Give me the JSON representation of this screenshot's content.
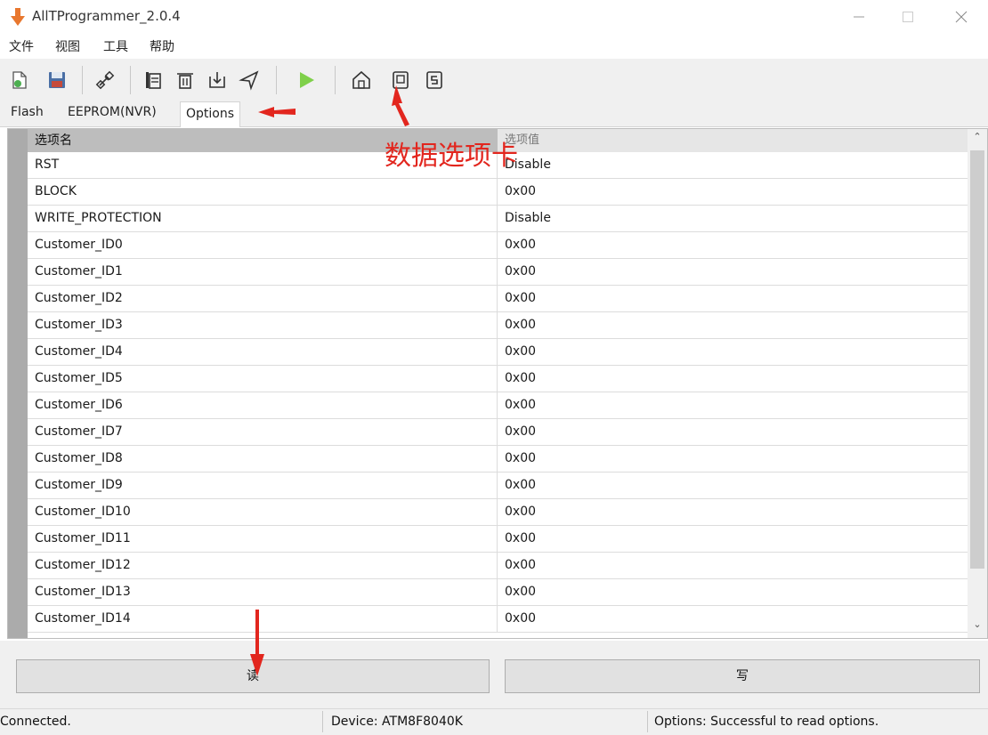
{
  "window": {
    "title": "AllTProgrammer_2.0.4",
    "min_icon": "minimize-icon",
    "max_icon": "maximize-icon",
    "close_icon": "close-icon"
  },
  "menu": [
    "文件",
    "视图",
    "工具",
    "帮助"
  ],
  "toolbar": {
    "icons": [
      "new-file-icon",
      "save-icon",
      "connect-icon",
      "copy-icon",
      "erase-icon",
      "download-icon",
      "send-icon",
      "run-icon",
      "home-icon",
      "data-option-icon",
      "s-icon"
    ]
  },
  "tabs": [
    {
      "label": "Flash"
    },
    {
      "label": "EEPROM(NVR)"
    },
    {
      "label": "Options"
    }
  ],
  "grid": {
    "headers": [
      "选项名",
      "选项值"
    ],
    "rows": [
      {
        "name": "RST",
        "value": "Disable"
      },
      {
        "name": "BLOCK",
        "value": "0x00"
      },
      {
        "name": "WRITE_PROTECTION",
        "value": "Disable"
      },
      {
        "name": "Customer_ID0",
        "value": "0x00"
      },
      {
        "name": "Customer_ID1",
        "value": "0x00"
      },
      {
        "name": "Customer_ID2",
        "value": "0x00"
      },
      {
        "name": "Customer_ID3",
        "value": "0x00"
      },
      {
        "name": "Customer_ID4",
        "value": "0x00"
      },
      {
        "name": "Customer_ID5",
        "value": "0x00"
      },
      {
        "name": "Customer_ID6",
        "value": "0x00"
      },
      {
        "name": "Customer_ID7",
        "value": "0x00"
      },
      {
        "name": "Customer_ID8",
        "value": "0x00"
      },
      {
        "name": "Customer_ID9",
        "value": "0x00"
      },
      {
        "name": "Customer_ID10",
        "value": "0x00"
      },
      {
        "name": "Customer_ID11",
        "value": "0x00"
      },
      {
        "name": "Customer_ID12",
        "value": "0x00"
      },
      {
        "name": "Customer_ID13",
        "value": "0x00"
      },
      {
        "name": "Customer_ID14",
        "value": "0x00"
      }
    ]
  },
  "buttons": {
    "read": "读",
    "write": "写"
  },
  "status": {
    "connection": "Connected.",
    "device": "Device: ATM8F8040K",
    "message": "Options: Successful to read options."
  },
  "annotation": {
    "text": "数据选项卡",
    "color": "#e2261e"
  }
}
